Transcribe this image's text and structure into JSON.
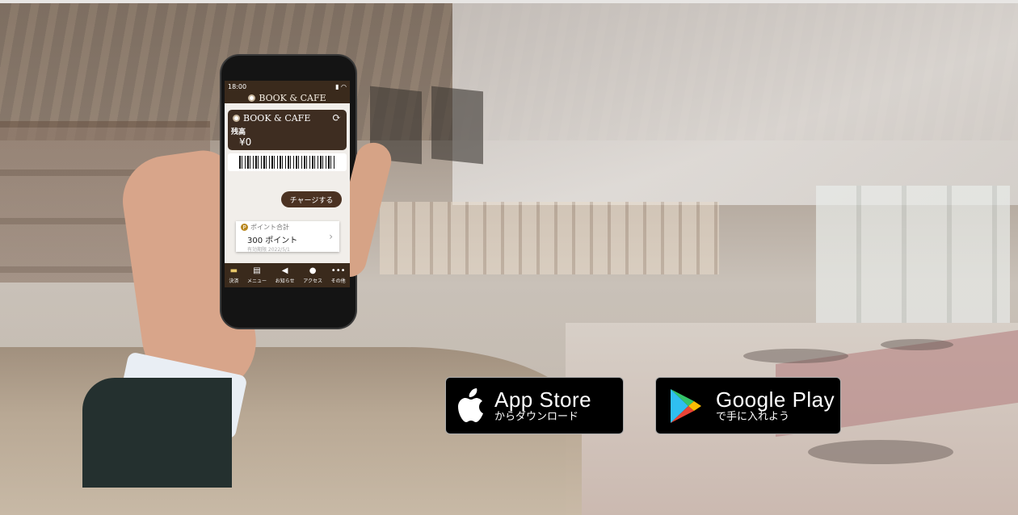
{
  "phone": {
    "status_time": "18:00",
    "app_title": "BOOK & CAFE",
    "card": {
      "brand": "BOOK & CAFE",
      "balance_label": "残高",
      "balance": "¥0"
    },
    "charge_button": "チャージする",
    "points": {
      "label": "ポイント合計",
      "value": "300 ポイント",
      "expiry": "有効期限 2022/5/1"
    },
    "tabs": [
      {
        "label": "決済",
        "icon": "payment-icon"
      },
      {
        "label": "メニュー",
        "icon": "menu-book-icon"
      },
      {
        "label": "お知らせ",
        "icon": "megaphone-icon"
      },
      {
        "label": "アクセス",
        "icon": "location-pin-icon"
      },
      {
        "label": "その他",
        "icon": "more-dots-icon"
      }
    ]
  },
  "app_store": {
    "title": "App Store",
    "subtitle": "からダウンロード",
    "icon": "apple-icon"
  },
  "google_play": {
    "title": "Google Play",
    "subtitle": "で手に入れよう",
    "icon": "google-play-icon"
  },
  "colors": {
    "app_brown": "#3a2a1c",
    "badge_black": "#000000"
  }
}
